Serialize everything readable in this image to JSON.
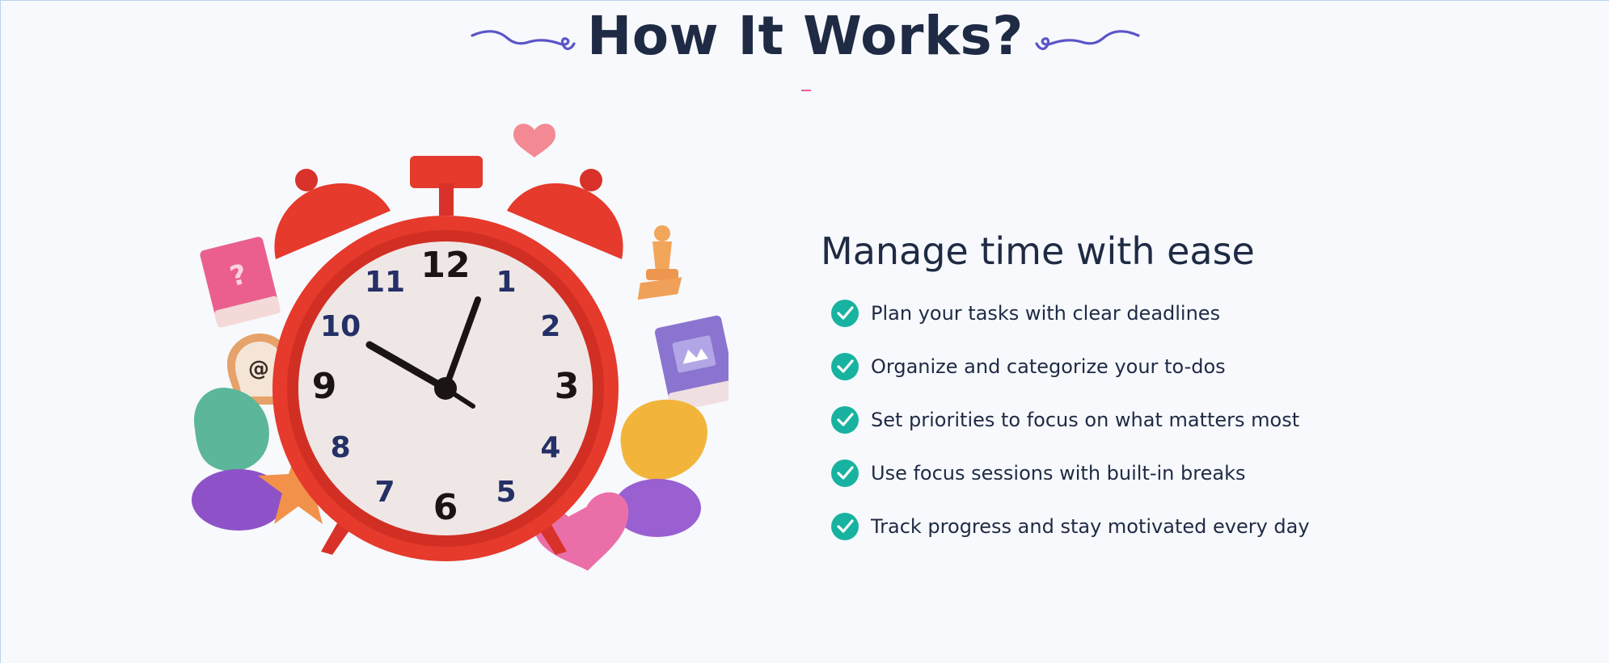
{
  "header": {
    "title": "How It Works?",
    "decor_icon": "swirl-ornament-icon",
    "accent_color": "#5a55c8",
    "underline_color": "#ec5c9a"
  },
  "illustration": {
    "icon": "alarm-clock-illustration",
    "clock_numbers": [
      "12",
      "1",
      "2",
      "3",
      "4",
      "5",
      "6",
      "7",
      "8",
      "9",
      "10",
      "11"
    ],
    "clock_color": "#e53a2c",
    "face_color": "#efe7e6"
  },
  "features": {
    "heading": "Manage time with ease",
    "check_icon": "check-circle-icon",
    "check_color": "#17b3a0",
    "items": [
      "Plan your tasks with clear deadlines",
      "Organize and categorize your to-dos",
      "Set priorities to focus on what matters most",
      "Use focus sessions with built-in breaks",
      "Track progress and stay motivated every day"
    ]
  }
}
